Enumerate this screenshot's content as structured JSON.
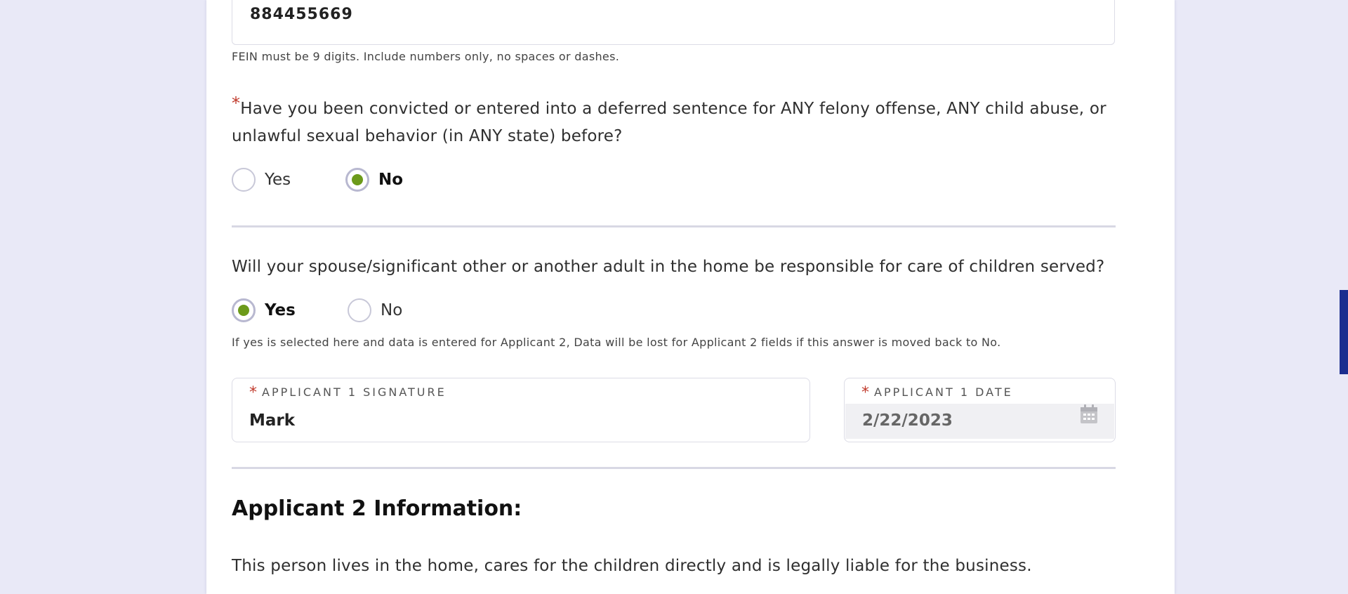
{
  "fein": {
    "value": "884455669",
    "hint": "FEIN must be 9 digits. Include numbers only, no spaces or dashes."
  },
  "felony_question": {
    "required_mark": "*",
    "text": "Have you been convicted or entered into a deferred sentence for ANY felony offense, ANY child abuse, or unlawful sexual behavior (in ANY state) before?",
    "options": [
      {
        "label": "Yes",
        "checked": false
      },
      {
        "label": "No",
        "checked": true
      }
    ]
  },
  "spouse_question": {
    "text": "Will your spouse/significant other or another adult in the home be responsible for care of children served?",
    "options": [
      {
        "label": "Yes",
        "checked": true
      },
      {
        "label": "No",
        "checked": false
      }
    ],
    "note": "If yes is selected here and data is entered for Applicant 2, Data will be lost for Applicant 2 fields if this answer is moved back to No."
  },
  "signature_field": {
    "required_mark": "*",
    "label": "APPLICANT 1 SIGNATURE",
    "value": "Mark"
  },
  "date_field": {
    "required_mark": "*",
    "label": "APPLICANT 1 DATE",
    "value": "2/22/2023",
    "icon": "calendar-icon"
  },
  "applicant2": {
    "heading": "Applicant 2 Information:",
    "description": "This person lives in the home, cares for the children directly and is legally liable for the business."
  },
  "colors": {
    "accent_radio": "#6c9a1a",
    "required": "#c0392b",
    "scroll_thumb": "#1b2e8f",
    "background": "#e9e9f7"
  }
}
